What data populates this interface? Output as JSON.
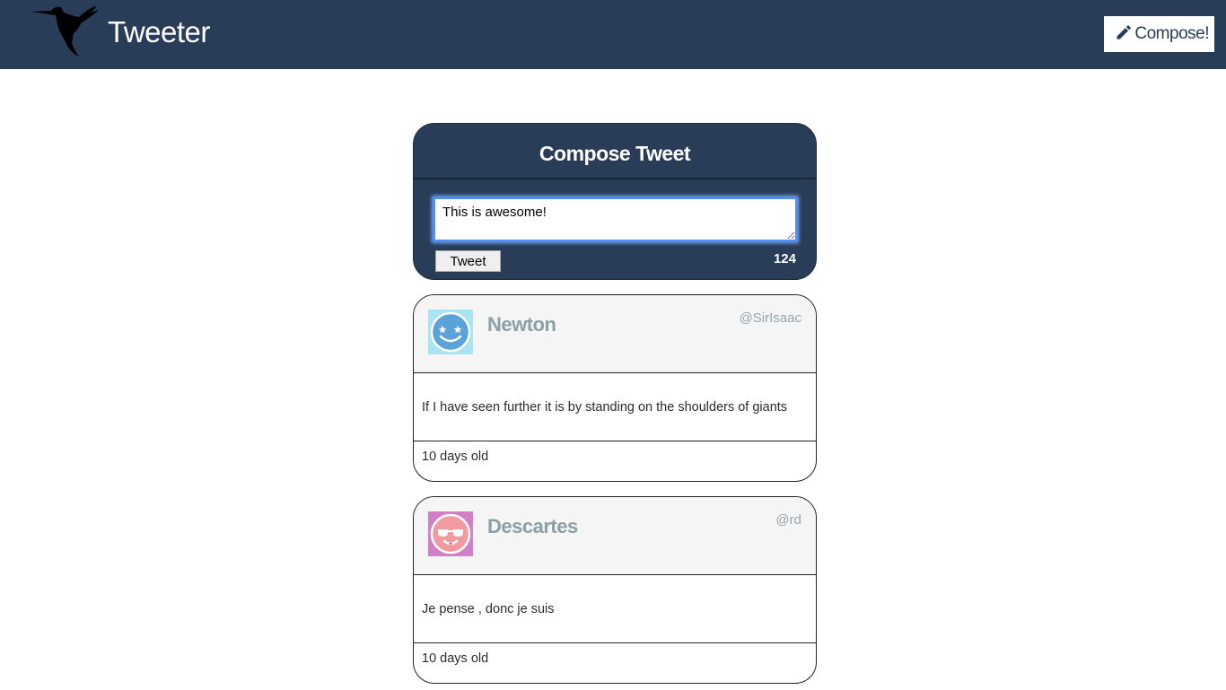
{
  "nav": {
    "brand": "Tweeter",
    "compose_label": "Compose!"
  },
  "compose": {
    "title": "Compose Tweet",
    "input_value": "This is awesome!",
    "tweet_button": "Tweet",
    "char_count": "124"
  },
  "tweets": [
    {
      "name": "Newton",
      "handle": "@SirIsaac",
      "content": "If I have seen further it is by standing on the shoulders of giants",
      "age": "10 days old",
      "avatar_color": "#a9e4f3"
    },
    {
      "name": "Descartes",
      "handle": "@rd",
      "content": "Je pense , donc je suis",
      "age": "10 days old",
      "avatar_color": "#d17fc6"
    }
  ],
  "colors": {
    "navbar": "#293c58",
    "compose_panel": "#293c58",
    "author_text": "#8a9fa6"
  }
}
